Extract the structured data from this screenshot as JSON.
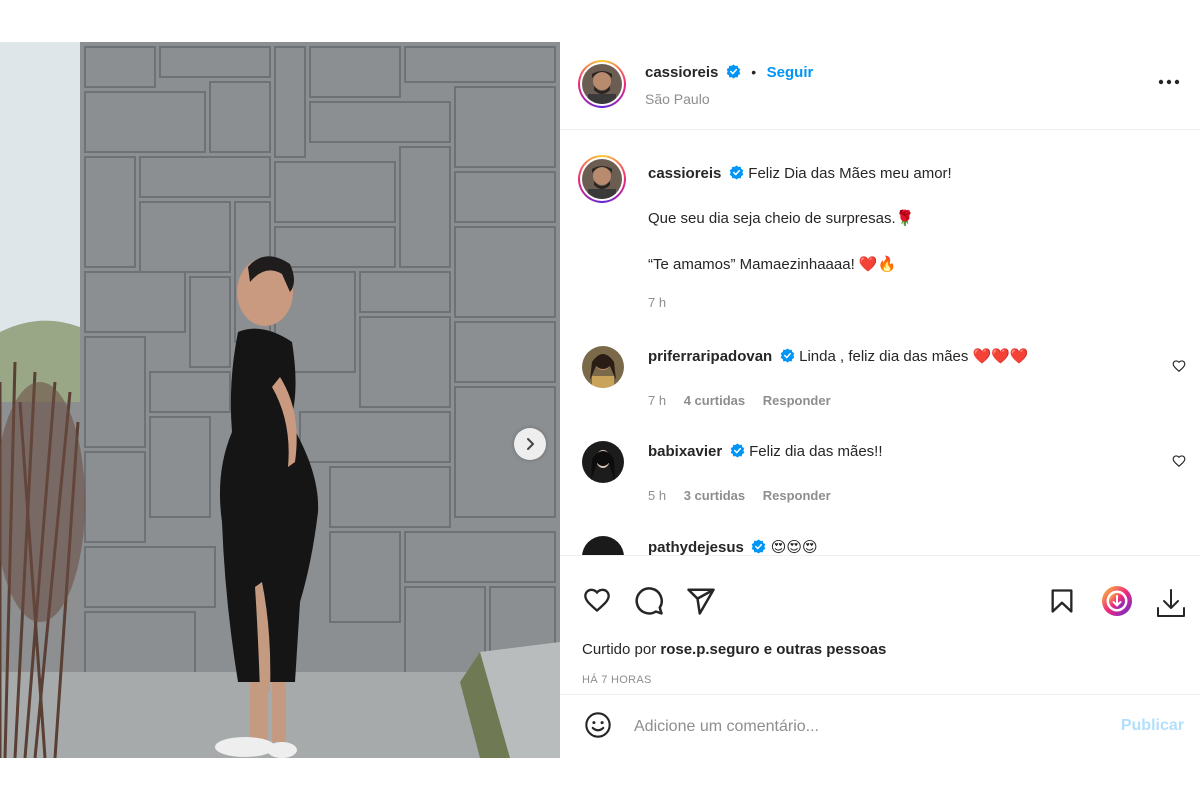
{
  "post": {
    "author": "cassioreis",
    "follow_label": "Seguir",
    "location": "São Paulo",
    "caption": {
      "line1": "Feliz Dia das Mães meu amor!",
      "line2": "Que seu dia seja cheio de surpresas.🌹",
      "line3": "“Te amamos” Mamaezinhaaaa! ❤️🔥",
      "time": "7 h"
    },
    "comments": [
      {
        "user": "priferraripadovan",
        "text": "Linda , feliz dia das mães ❤️❤️❤️",
        "time": "7 h",
        "likes": "4 curtidas",
        "reply": "Responder"
      },
      {
        "user": "babixavier",
        "text": "Feliz dia das mães!!",
        "time": "5 h",
        "likes": "3 curtidas",
        "reply": "Responder"
      },
      {
        "user": "pathydejesus",
        "text": "😍😍😍"
      }
    ],
    "liked_by_prefix": "Curtido por",
    "liked_by_user": "rose.p.seguro",
    "liked_by_suffix": "e outras pessoas",
    "time_ago": "HÁ 7 HORAS"
  },
  "comment_box": {
    "placeholder": "Adicione um comentário...",
    "publish_label": "Publicar"
  },
  "colors": {
    "accent": "#0095f6",
    "verified": "#0095f6",
    "muted": "#8e8e8e",
    "publish_disabled": "#b2dffc"
  }
}
